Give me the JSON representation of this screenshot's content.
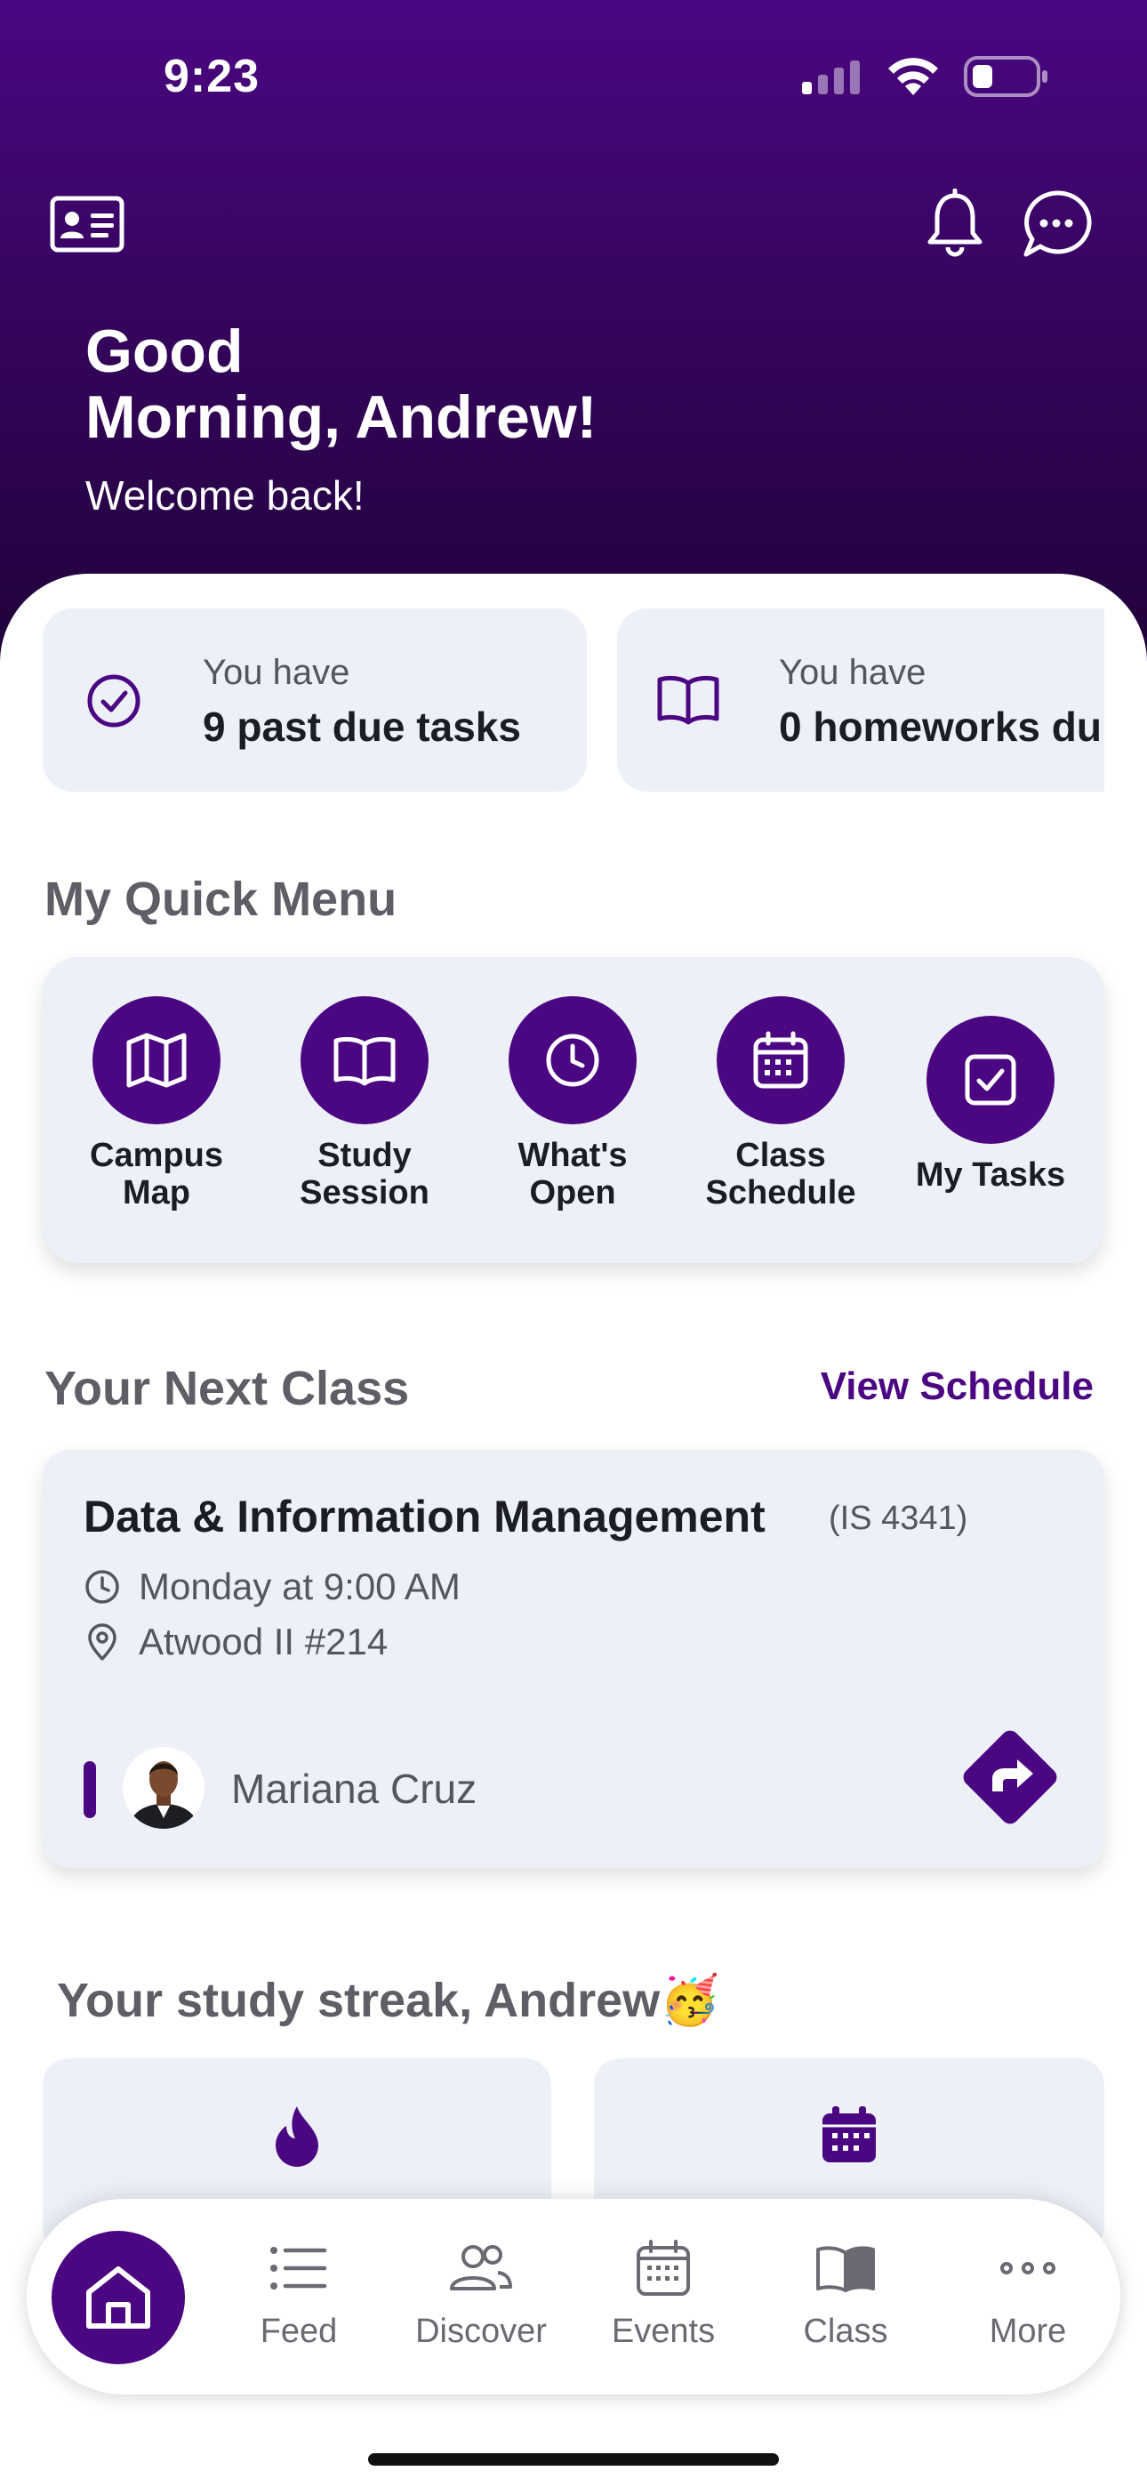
{
  "status_bar": {
    "time": "9:23"
  },
  "header": {
    "greeting_line1": "Good",
    "greeting_line2": "Morning, Andrew!",
    "subtitle": "Welcome back!",
    "left_icon": "id-card-icon",
    "right_icons": [
      "bell-icon",
      "chat-bubble-icon"
    ]
  },
  "summary_cards": [
    {
      "icon": "check-circle-icon",
      "pre": "You have",
      "main": "9 past due tasks"
    },
    {
      "icon": "book-open-icon",
      "pre": "You have",
      "main": "0 homeworks du"
    }
  ],
  "quick_menu": {
    "title": "My Quick Menu",
    "items": [
      {
        "icon": "map-icon",
        "label_line1": "Campus",
        "label_line2": "Map"
      },
      {
        "icon": "book-open-icon",
        "label_line1": "Study",
        "label_line2": "Session"
      },
      {
        "icon": "clock-icon",
        "label_line1": "What's",
        "label_line2": "Open"
      },
      {
        "icon": "calendar-icon",
        "label_line1": "Class",
        "label_line2": "Schedule"
      },
      {
        "icon": "checkbox-icon",
        "label_line1": "My Tasks",
        "label_line2": ""
      }
    ]
  },
  "next_class": {
    "title": "Your Next Class",
    "link": "View Schedule",
    "course_name": "Data & Information Management",
    "course_code": "(IS 4341)",
    "time": "Monday at 9:00 AM",
    "location": "Atwood II #214",
    "instructor": "Mariana Cruz"
  },
  "streak": {
    "title": "Your study streak, Andrew",
    "emoji": "🥳",
    "cards": [
      {
        "icon": "flame-icon"
      },
      {
        "icon": "calendar-icon"
      }
    ]
  },
  "tabbar": {
    "home_icon": "home-icon",
    "tabs": [
      {
        "icon": "list-icon",
        "label": "Feed"
      },
      {
        "icon": "people-icon",
        "label": "Discover"
      },
      {
        "icon": "calendar-icon",
        "label": "Events"
      },
      {
        "icon": "book-icon",
        "label": "Class"
      },
      {
        "icon": "more-dots-icon",
        "label": "More"
      }
    ]
  },
  "colors": {
    "brand": "#4b0682",
    "card_bg": "#eef0f8",
    "muted_text": "#5e5e66"
  }
}
